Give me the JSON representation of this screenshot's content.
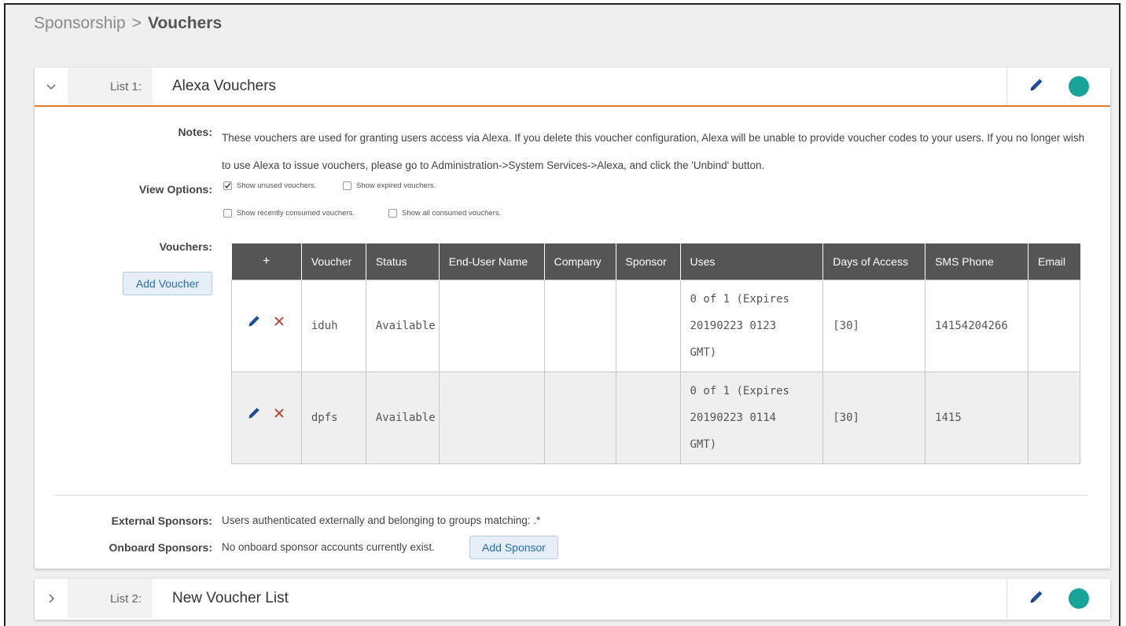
{
  "breadcrumb": {
    "root": "Sponsorship",
    "separator": ">",
    "current": "Vouchers"
  },
  "lists": [
    {
      "label": "List 1:",
      "title": "Alexa Vouchers",
      "expanded": true,
      "notes_label": "Notes:",
      "notes": "These vouchers are used for granting users access via Alexa. If you delete this voucher configuration, Alexa will be unable to provide voucher codes to your users. If you no longer wish to use Alexa to issue vouchers, please go to Administration->System Services->Alexa, and click the 'Unbind' button.",
      "view_options_label": "View Options:",
      "view_options": [
        {
          "label": "Show unused vouchers.",
          "checked": true
        },
        {
          "label": "Show expired vouchers.",
          "checked": false
        },
        {
          "label": "Show recently consumed vouchers.",
          "checked": false
        },
        {
          "label": "Show all consumed vouchers.",
          "checked": false
        }
      ],
      "vouchers_label": "Vouchers:",
      "add_voucher_label": "Add Voucher",
      "table": {
        "columns": [
          "+",
          "Voucher",
          "Status",
          "End-User Name",
          "Company",
          "Sponsor",
          "Uses",
          "Days of Access",
          "SMS Phone",
          "Email"
        ],
        "rows": [
          {
            "voucher": "iduh",
            "status": "Available",
            "end_user_name": "",
            "company": "",
            "sponsor": "",
            "uses_1": "0 of 1 (Expires",
            "uses_2": "20190223 0123",
            "uses_3": "GMT)",
            "days_of_access": "[30]",
            "sms_phone": "14154204266",
            "email": ""
          },
          {
            "voucher": "dpfs",
            "status": "Available",
            "end_user_name": "",
            "company": "",
            "sponsor": "",
            "uses_1": "0 of 1 (Expires",
            "uses_2": "20190223 0114",
            "uses_3": "GMT)",
            "days_of_access": "[30]",
            "sms_phone": "1415",
            "email": ""
          }
        ]
      },
      "external_sponsors_label": "External Sponsors:",
      "external_sponsors": "Users authenticated externally and belonging to groups matching: .*",
      "onboard_sponsors_label": "Onboard Sponsors:",
      "onboard_sponsors": "No onboard sponsor accounts currently exist.",
      "add_sponsor_label": "Add Sponsor",
      "status_color": "#17a39a"
    },
    {
      "label": "List 2:",
      "title": "New Voucher List",
      "expanded": false,
      "status_color": "#17a39a"
    }
  ],
  "colors": {
    "accent": "#e07a2c",
    "header_bg": "#555555",
    "link": "#2a6db5",
    "edit_icon": "#1a4d9a",
    "delete_icon": "#c0392b"
  },
  "icons": {
    "expand_open": "chevron-down-icon",
    "expand_closed": "chevron-right-icon",
    "edit": "pencil-icon",
    "delete": "x-icon",
    "status": "status-dot"
  }
}
